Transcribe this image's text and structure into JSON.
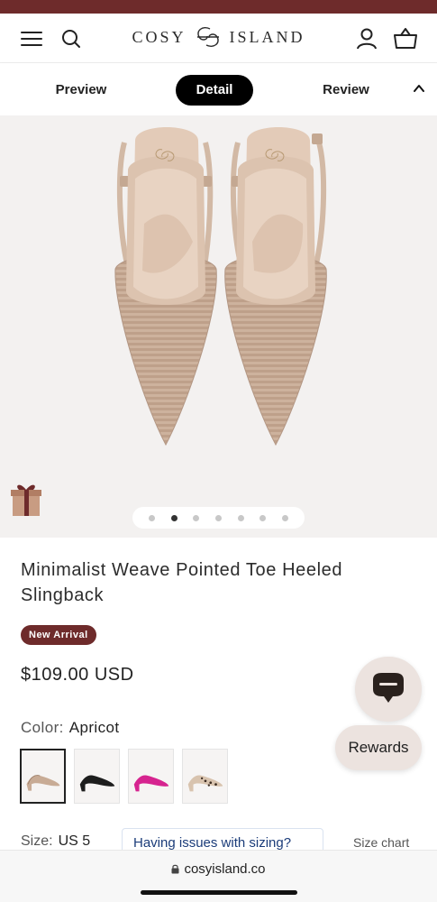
{
  "brand": {
    "logo_left": "COSY",
    "logo_right": "ISLAND",
    "accent_color": "#6e2b2b"
  },
  "header": {
    "menu_icon": "hamburger-icon",
    "search_icon": "search-icon",
    "account_icon": "user-icon",
    "cart_icon": "basket-icon"
  },
  "tabs": [
    {
      "label": "Preview"
    },
    {
      "label": "Detail",
      "active": true
    },
    {
      "label": "Review"
    }
  ],
  "gallery": {
    "image_count": 7,
    "active_index": 1
  },
  "product": {
    "title": "Minimalist Weave Pointed Toe Heeled Slingback",
    "badge": "New Arrival",
    "price": "$109.00 USD",
    "color_label": "Color:",
    "color_value": "Apricot",
    "swatches": [
      {
        "color": "Apricot",
        "hex": "#c8ab95",
        "selected": true
      },
      {
        "color": "Black",
        "hex": "#1d1d1d"
      },
      {
        "color": "Pink",
        "hex": "#d6248f"
      },
      {
        "color": "Leopard",
        "hex": "#b99a7c"
      }
    ],
    "size_label": "Size:",
    "size_value": "US 5",
    "sizing_help": "Having issues with sizing?",
    "size_chart": "Size chart"
  },
  "floating": {
    "chat_icon": "chat-bubble-icon",
    "rewards_label": "Rewards"
  },
  "browser": {
    "url": "cosyisland.co"
  }
}
